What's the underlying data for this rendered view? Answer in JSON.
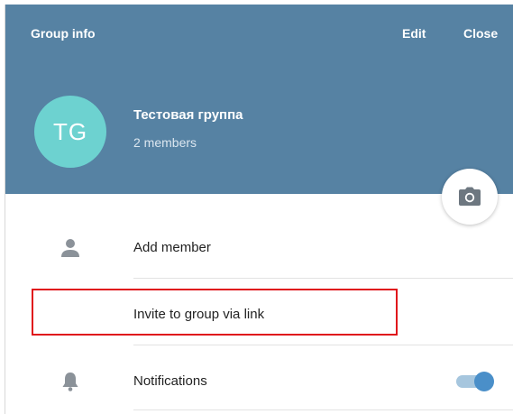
{
  "header": {
    "title": "Group info",
    "edit_label": "Edit",
    "close_label": "Close",
    "background_color": "#5682a3"
  },
  "group": {
    "initials": "TG",
    "name": "Тестовая группа",
    "members": "2 members",
    "avatar_color": "#6dd2d0"
  },
  "camera_button": {
    "icon": "camera-icon"
  },
  "menu": {
    "add_member": {
      "label": "Add member",
      "icon": "person-icon"
    },
    "invite_link": {
      "label": "Invite to group via link",
      "highlighted": true,
      "highlight_color": "#e0141b"
    },
    "notifications": {
      "label": "Notifications",
      "icon": "bell-icon",
      "enabled": true
    }
  }
}
